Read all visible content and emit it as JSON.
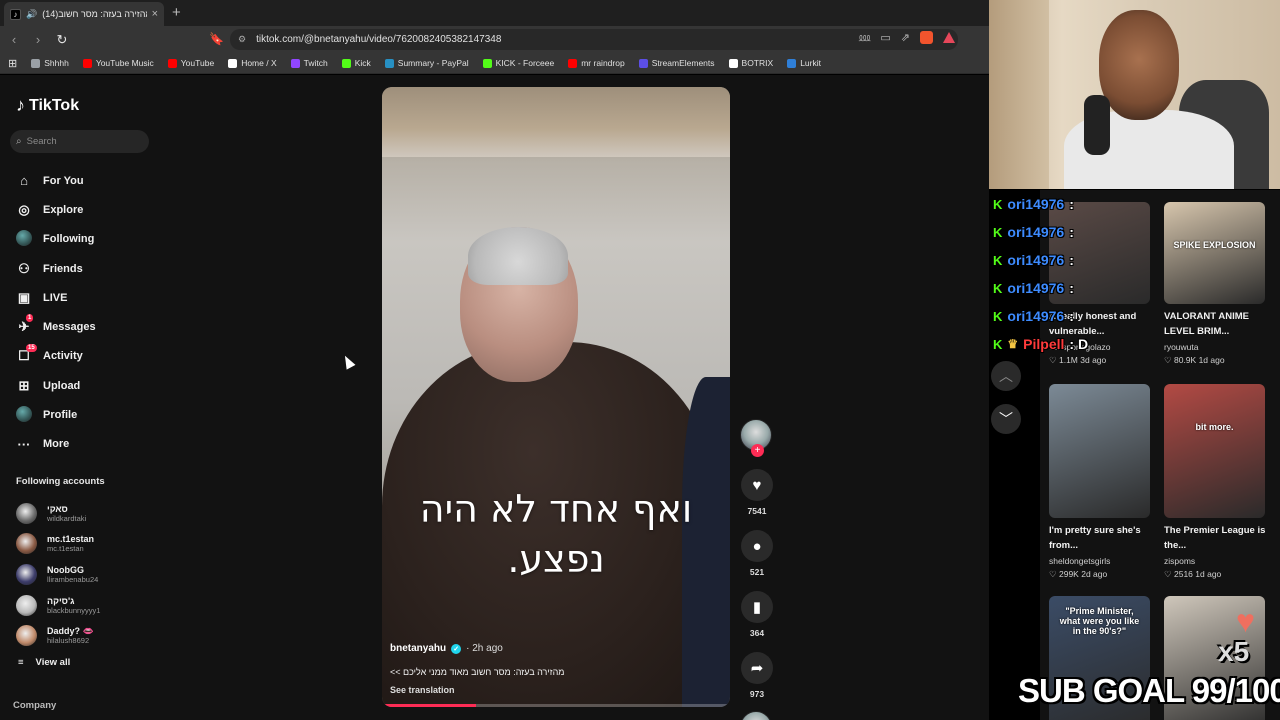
{
  "browser": {
    "tab_title": "(14)מהזירה בעזה: מסר חשוב",
    "new_tab_label": "+",
    "url": "tiktok.com/@bnetanyahu/video/7620082405382147348",
    "bookmarks": [
      {
        "label": "Shhhh",
        "color": "#9aa0a6"
      },
      {
        "label": "YouTube Music",
        "color": "#ff0000"
      },
      {
        "label": "YouTube",
        "color": "#ff0000"
      },
      {
        "label": "Home / X",
        "color": "#ffffff"
      },
      {
        "label": "Twitch",
        "color": "#9146ff"
      },
      {
        "label": "Kick",
        "color": "#53fc18"
      },
      {
        "label": "Summary - PayPal",
        "color": "#2790c3"
      },
      {
        "label": "KICK - Forceee",
        "color": "#53fc18"
      },
      {
        "label": "mr raindrop",
        "color": "#ff0000"
      },
      {
        "label": "StreamElements",
        "color": "#5c4ee5"
      },
      {
        "label": "BOTRIX",
        "color": "#ffffff"
      },
      {
        "label": "Lurkit",
        "color": "#2f7fd8"
      }
    ]
  },
  "tiktok": {
    "logo": "TikTok",
    "search_placeholder": "Search",
    "nav": [
      {
        "label": "For You",
        "icon": "home-icon",
        "glyph": "⌂"
      },
      {
        "label": "Explore",
        "icon": "compass-icon",
        "glyph": "◎"
      },
      {
        "label": "Following",
        "icon": "following-avatar-icon",
        "glyph": ""
      },
      {
        "label": "Friends",
        "icon": "friends-icon",
        "glyph": "⚇"
      },
      {
        "label": "LIVE",
        "icon": "live-icon",
        "glyph": "▣"
      },
      {
        "label": "Messages",
        "icon": "messages-icon",
        "glyph": "✈",
        "badge": "1"
      },
      {
        "label": "Activity",
        "icon": "activity-icon",
        "glyph": "☐",
        "badge": "15"
      },
      {
        "label": "Upload",
        "icon": "upload-icon",
        "glyph": "⊞"
      },
      {
        "label": "Profile",
        "icon": "profile-icon",
        "glyph": ""
      },
      {
        "label": "More",
        "icon": "more-icon",
        "glyph": "···"
      }
    ],
    "following_title": "Following accounts",
    "following": [
      {
        "name": "סאקי",
        "handle": "wildkardtaki",
        "color": "#6b6b6b"
      },
      {
        "name": "mc.t1estan",
        "handle": "mc.t1estan",
        "color": "#8a5a44"
      },
      {
        "name": "NoobGG",
        "handle": "llirambenabu24",
        "color": "#3c3c6a"
      },
      {
        "name": "ג'סיקה",
        "handle": "blackbunnyyyy1",
        "color": "#b9b9b9"
      },
      {
        "name": "Daddy? 👄",
        "handle": "hilalush8692",
        "color": "#c08a6a"
      }
    ],
    "view_all": "View all",
    "company": "Company",
    "video": {
      "caption_line1": "ואף אחד לא היה",
      "caption_line2": "נפצע.",
      "author": "bnetanyahu",
      "time": "· 2h ago",
      "description": "מהזירה בעזה: מסר חשוב מאוד ממני אליכם >>",
      "see_translation": "See translation",
      "progress": 0.27
    },
    "actions": {
      "likes": "7541",
      "comments": "521",
      "saves": "364",
      "shares": "973"
    }
  },
  "stream": {
    "chat": [
      {
        "user": "ori14976",
        "text": ":"
      },
      {
        "user": "ori14976",
        "text": ":"
      },
      {
        "user": "ori14976",
        "text": ":"
      },
      {
        "user": "ori14976",
        "text": ":"
      },
      {
        "user": "ori14976",
        "text": ":"
      },
      {
        "user": "Pilpell",
        "text": ": D"
      }
    ],
    "grid": [
      {
        "caption": "A really honest and vulnerable...",
        "user": "cbssportsgolazo",
        "likes": "1.1M",
        "age": "3d ago",
        "color": "#5a4a46"
      },
      {
        "caption": "VALORANT ANIME LEVEL BRIM...",
        "user": "ryouwuta",
        "likes": "80.9K",
        "age": "1d ago",
        "color": "#d7c6ad",
        "overlay": "SPIKE EXPLOSION"
      },
      {
        "caption": "I'm pretty sure she's from...",
        "user": "sheldongetsgirls",
        "likes": "299K",
        "age": "2d ago",
        "color": "#7c8a96"
      },
      {
        "caption": "The Premier League is the...",
        "user": "zispoms",
        "likes": "2516",
        "age": "1d ago",
        "color": "#b34a44",
        "overlay": "bit more."
      },
      {
        "caption": "",
        "user": "",
        "likes": "",
        "age": "",
        "color": "#3b4c66",
        "overlay": "\"Prime Minister, what were you like in the 90's?\""
      },
      {
        "caption": "",
        "user": "",
        "likes": "",
        "age": "",
        "color": "#cfc7bb"
      }
    ],
    "sub_goal": "SUB GOAL 99/100",
    "multiplier": "x5"
  }
}
